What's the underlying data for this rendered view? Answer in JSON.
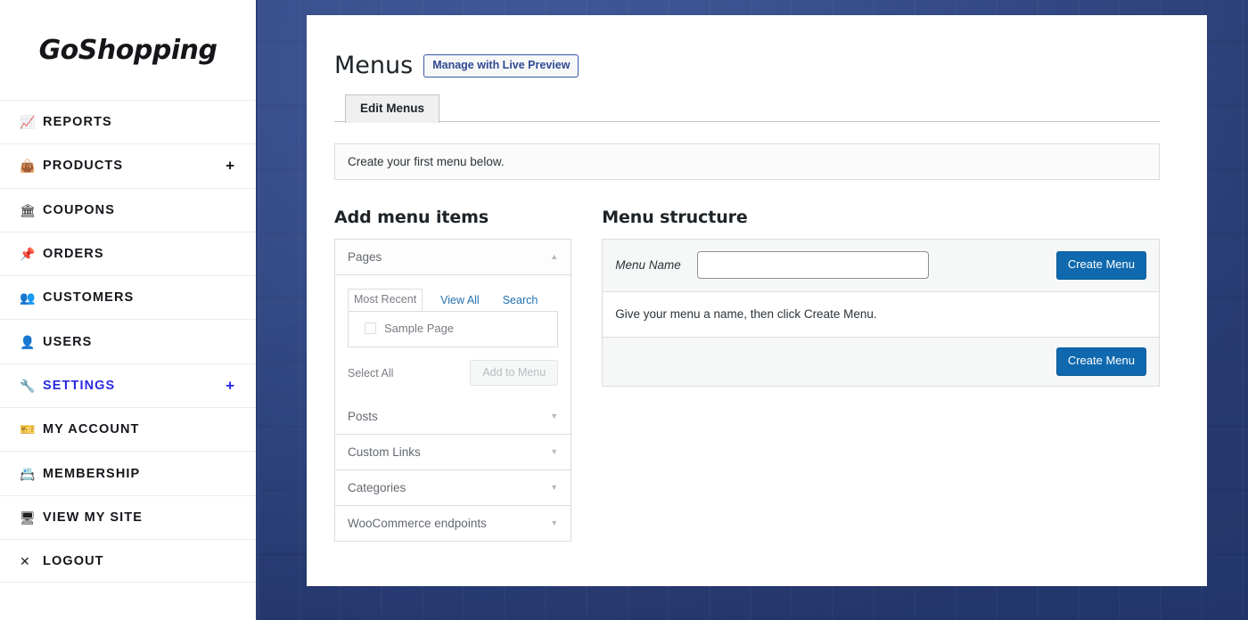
{
  "brand": {
    "name": "GoShopping"
  },
  "sidebar": {
    "items": [
      {
        "label": "REPORTS",
        "icon": "chart-icon",
        "glyph": "📈",
        "plus": false,
        "active": false
      },
      {
        "label": "PRODUCTS",
        "icon": "bag-icon",
        "glyph": "👜",
        "plus": true,
        "active": false
      },
      {
        "label": "COUPONS",
        "icon": "coupons-icon",
        "glyph": "🏛",
        "plus": false,
        "active": false
      },
      {
        "label": "ORDERS",
        "icon": "pushpin-icon",
        "glyph": "📌",
        "plus": false,
        "active": false
      },
      {
        "label": "CUSTOMERS",
        "icon": "people-icon",
        "glyph": "👥",
        "plus": false,
        "active": false
      },
      {
        "label": "USERS",
        "icon": "person-icon",
        "glyph": "👤",
        "plus": false,
        "active": false
      },
      {
        "label": "SETTINGS",
        "icon": "wrench-icon",
        "glyph": "🔧",
        "plus": true,
        "active": true
      },
      {
        "label": "MY ACCOUNT",
        "icon": "id-card-icon",
        "glyph": "🎫",
        "plus": false,
        "active": false
      },
      {
        "label": "MEMBERSHIP",
        "icon": "membership-card-icon",
        "glyph": "📇",
        "plus": false,
        "active": false
      },
      {
        "label": "VIEW MY SITE",
        "icon": "monitor-icon",
        "glyph": "🖥",
        "plus": false,
        "active": false
      },
      {
        "label": "LOGOUT",
        "icon": "close-x-icon",
        "glyph": "✕",
        "plus": false,
        "active": false
      }
    ],
    "plus_symbol": "+"
  },
  "page": {
    "title": "Menus",
    "live_preview_button": "Manage with Live Preview",
    "tab": "Edit Menus",
    "notice": "Create your first menu below."
  },
  "add_menu_items": {
    "heading": "Add menu items",
    "pages_panel": {
      "label": "Pages",
      "caret": "▲",
      "tabs": [
        {
          "label": "Most Recent",
          "active": true
        },
        {
          "label": "View All",
          "active": false
        },
        {
          "label": "Search",
          "active": false
        }
      ],
      "items": [
        {
          "label": "Sample Page",
          "checked": false
        }
      ],
      "select_all": "Select All",
      "add_to_menu": "Add to Menu"
    },
    "panels": [
      {
        "label": "Posts",
        "caret": "▼"
      },
      {
        "label": "Custom Links",
        "caret": "▼"
      },
      {
        "label": "Categories",
        "caret": "▼"
      },
      {
        "label": "WooCommerce endpoints",
        "caret": "▼"
      }
    ]
  },
  "menu_structure": {
    "heading": "Menu structure",
    "name_label": "Menu Name",
    "name_value": "",
    "name_placeholder": "",
    "create_button_top": "Create Menu",
    "hint": "Give your menu a name, then click Create Menu.",
    "create_button_bottom": "Create Menu"
  },
  "colors": {
    "background_blue": "#2f4a92",
    "sidebar_border": "#2b3d77",
    "accent_blue": "#1069ae",
    "active_nav": "#2a2ae0",
    "link_blue": "#2271b1"
  }
}
